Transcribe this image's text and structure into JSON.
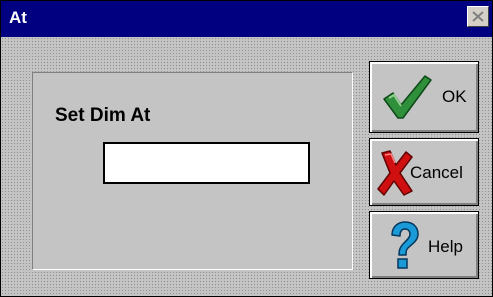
{
  "window": {
    "title": "At"
  },
  "dialog": {
    "prompt_label": "Set Dim At",
    "input_value": ""
  },
  "buttons": {
    "ok_label": "OK",
    "cancel_label": "Cancel",
    "help_label": "Help"
  },
  "icons": {
    "ok": "checkmark-icon",
    "cancel": "red-x-icon",
    "help": "question-mark-icon",
    "close": "close-icon"
  },
  "colors": {
    "titlebar": "#000080",
    "face": "#c4c4c4",
    "check_green": "#2f8f3a",
    "cancel_red": "#d01010",
    "help_blue": "#1a9ad6"
  }
}
